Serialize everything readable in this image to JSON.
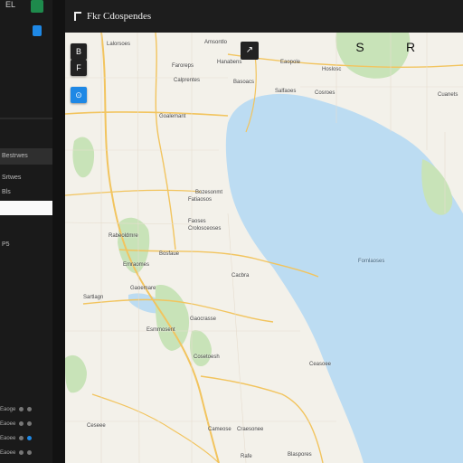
{
  "sidebar": {
    "top_label": "EL",
    "items": [
      {
        "label": "Bestrwes"
      },
      {
        "label": "Srtwes"
      },
      {
        "label": "Bls"
      }
    ],
    "section_label": "P5",
    "rows": [
      {
        "label": "Eaoge"
      },
      {
        "label": "Eaoee"
      },
      {
        "label": "Eaoee"
      },
      {
        "label": "Eaoee"
      }
    ]
  },
  "header": {
    "title": "Fkr Cdospendes"
  },
  "map": {
    "controls": [
      {
        "glyph": "B"
      },
      {
        "glyph": "F"
      },
      {
        "glyph": "&#x2299;"
      }
    ],
    "icons": [
      {
        "glyph": "&#x2197;"
      },
      {
        "glyph": "S&#xFE0E;"
      },
      {
        "glyph": "R"
      }
    ],
    "labels": [
      {
        "text": "Lalorsoes"
      },
      {
        "text": "Amsontlo"
      },
      {
        "text": "Eaopole"
      },
      {
        "text": "Faroreps"
      },
      {
        "text": "Hanabens"
      },
      {
        "text": "Hoslosc"
      },
      {
        "text": "Calprentes"
      },
      {
        "text": "Basoacs"
      },
      {
        "text": "Salfaoes"
      },
      {
        "text": "Cosroes"
      },
      {
        "text": "Cuanets"
      },
      {
        "text": "Goalemant"
      },
      {
        "text": "Bozesonmt"
      },
      {
        "text": "Fatiaosos"
      },
      {
        "text": "Faoses"
      },
      {
        "text": "Rabeoldmre"
      },
      {
        "text": "Crolosceoses"
      },
      {
        "text": "Emraomes"
      },
      {
        "text": "Bosfaue"
      },
      {
        "text": "Cacbra"
      },
      {
        "text": "Sartlagn"
      },
      {
        "text": "Gaoemare"
      },
      {
        "text": "Gaocrasse"
      },
      {
        "text": "Esmmosent"
      },
      {
        "text": "Cosetoesh"
      },
      {
        "text": "Ceasoee"
      },
      {
        "text": "Fomlaoses"
      },
      {
        "text": "Cameose"
      },
      {
        "text": "Craesonee"
      },
      {
        "text": "Rafe"
      },
      {
        "text": "Ceseee"
      },
      {
        "text": "Blaspores"
      }
    ]
  },
  "colors": {
    "land": "#f3f1ea",
    "water": "#bcdcf2",
    "park": "#c8e3b8",
    "road": "#f2c45e",
    "accent": "#1e88e5",
    "sidebar": "#1a1a1a"
  }
}
